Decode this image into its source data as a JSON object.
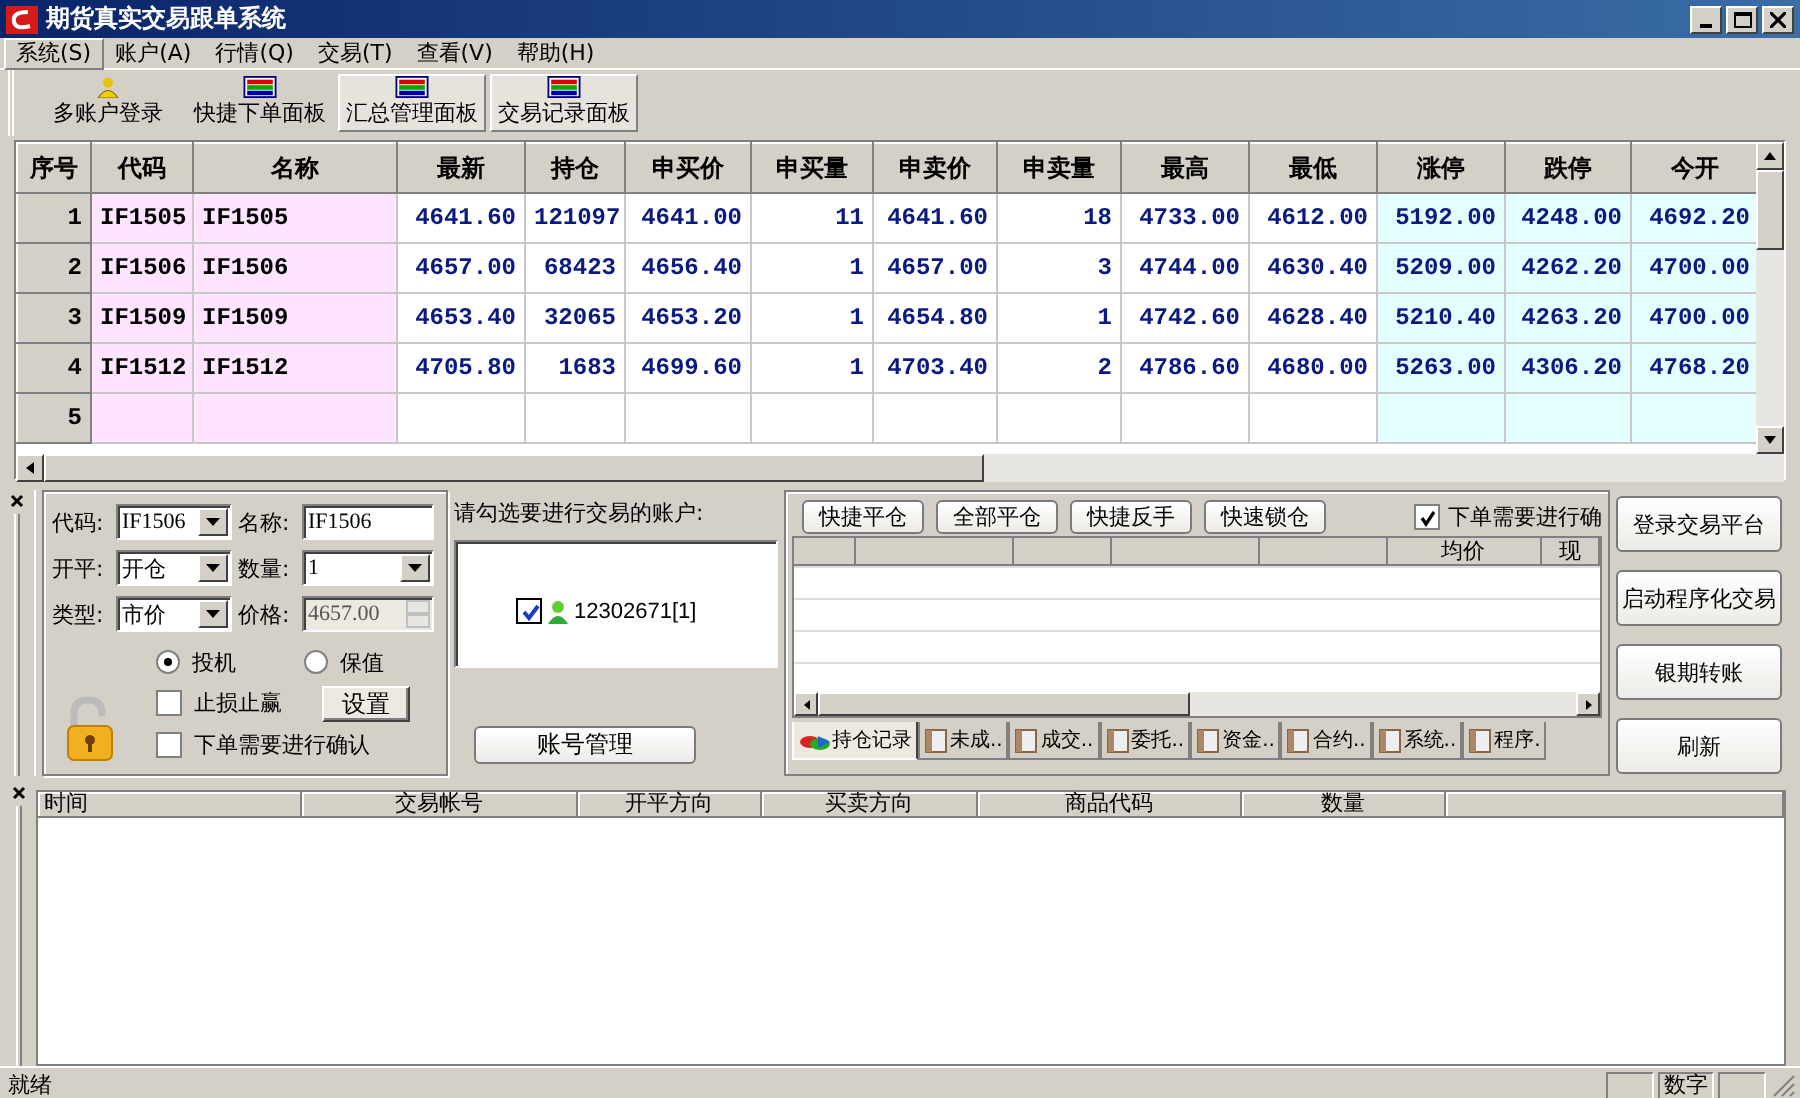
{
  "window": {
    "title": "期货真实交易跟单系统"
  },
  "menu": [
    {
      "label": "系统(S)",
      "selected": true
    },
    {
      "label": "账户(A)",
      "selected": false
    },
    {
      "label": "行情(Q)",
      "selected": false
    },
    {
      "label": "交易(T)",
      "selected": false
    },
    {
      "label": "查看(V)",
      "selected": false
    },
    {
      "label": "帮助(H)",
      "selected": false
    }
  ],
  "toolbar": [
    {
      "label": "多账户登录",
      "kind": "users",
      "pressed": false
    },
    {
      "label": "快捷下单面板",
      "kind": "panel",
      "pressed": false
    },
    {
      "label": "汇总管理面板",
      "kind": "panel",
      "pressed": true
    },
    {
      "label": "交易记录面板",
      "kind": "panel",
      "pressed": true
    }
  ],
  "quotes": {
    "columns": [
      {
        "label": "序号",
        "kind": "index"
      },
      {
        "label": "代码",
        "kind": "code"
      },
      {
        "label": "名称",
        "kind": "code"
      },
      {
        "label": "最新",
        "kind": "number"
      },
      {
        "label": "持仓",
        "kind": "number"
      },
      {
        "label": "申买价",
        "kind": "number"
      },
      {
        "label": "申买量",
        "kind": "number"
      },
      {
        "label": "申卖价",
        "kind": "number"
      },
      {
        "label": "申卖量",
        "kind": "number"
      },
      {
        "label": "最高",
        "kind": "number"
      },
      {
        "label": "最低",
        "kind": "number"
      },
      {
        "label": "涨停",
        "kind": "limit"
      },
      {
        "label": "跌停",
        "kind": "limit"
      },
      {
        "label": "今开",
        "kind": "limit"
      }
    ],
    "rows": [
      [
        "1",
        "IF1505",
        "IF1505",
        "4641.60",
        "121097",
        "4641.00",
        "11",
        "4641.60",
        "18",
        "4733.00",
        "4612.00",
        "5192.00",
        "4248.00",
        "4692.20"
      ],
      [
        "2",
        "IF1506",
        "IF1506",
        "4657.00",
        "68423",
        "4656.40",
        "1",
        "4657.00",
        "3",
        "4744.00",
        "4630.40",
        "5209.00",
        "4262.20",
        "4700.00"
      ],
      [
        "3",
        "IF1509",
        "IF1509",
        "4653.40",
        "32065",
        "4653.20",
        "1",
        "4654.80",
        "1",
        "4742.60",
        "4628.40",
        "5210.40",
        "4263.20",
        "4700.00"
      ],
      [
        "4",
        "IF1512",
        "IF1512",
        "4705.80",
        "1683",
        "4699.60",
        "1",
        "4703.40",
        "2",
        "4786.60",
        "4680.00",
        "5263.00",
        "4306.20",
        "4768.20"
      ],
      [
        "5",
        "",
        "",
        "",
        "",
        "",
        "",
        "",
        "",
        "",
        "",
        "",
        "",
        ""
      ]
    ]
  },
  "order": {
    "fields": [
      {
        "label": "代码:",
        "value": "IF1506",
        "kind": "combo",
        "disabled": false
      },
      {
        "label": "名称:",
        "value": "IF1506",
        "kind": "text",
        "disabled": false
      },
      {
        "label": "开平:",
        "value": "开仓",
        "kind": "combo",
        "disabled": false
      },
      {
        "label": "数量:",
        "value": "1",
        "kind": "combo",
        "disabled": false
      },
      {
        "label": "类型:",
        "value": "市价",
        "kind": "combo",
        "disabled": false
      },
      {
        "label": "价格:",
        "value": "4657.00",
        "kind": "spin",
        "disabled": true
      }
    ],
    "radios": [
      {
        "label": "投机",
        "selected": true
      },
      {
        "label": "保值",
        "selected": false
      }
    ],
    "checks": [
      {
        "label": "止损止赢",
        "checked": false
      },
      {
        "label": "下单需要进行确认",
        "checked": false
      }
    ],
    "settings_button": "设置"
  },
  "accounts": {
    "prompt": "请勾选要进行交易的账户:",
    "items": [
      {
        "label": "12302671[1]",
        "checked": true
      }
    ],
    "manage_button": "账号管理"
  },
  "positions": {
    "buttons": [
      "快捷平仓",
      "全部平仓",
      "快捷反手",
      "快速锁仓"
    ],
    "confirm": {
      "label": "下单需要进行确",
      "checked": true
    },
    "columns": [
      "均价",
      "现"
    ],
    "tabs": [
      {
        "label": "持仓记录",
        "selected": true
      },
      {
        "label": "未成..",
        "selected": false
      },
      {
        "label": "成交..",
        "selected": false
      },
      {
        "label": "委托..",
        "selected": false
      },
      {
        "label": "资金..",
        "selected": false
      },
      {
        "label": "合约..",
        "selected": false
      },
      {
        "label": "系统..",
        "selected": false
      },
      {
        "label": "程序.",
        "selected": false
      }
    ]
  },
  "actions": [
    "登录交易平台",
    "启动程序化交易",
    "银期转账",
    "刷新"
  ],
  "log": {
    "columns": [
      "时间",
      "交易帐号",
      "开平方向",
      "买卖方向",
      "商品代码",
      "数量"
    ]
  },
  "status_bar": {
    "message": "就绪",
    "indicator": "数字"
  }
}
